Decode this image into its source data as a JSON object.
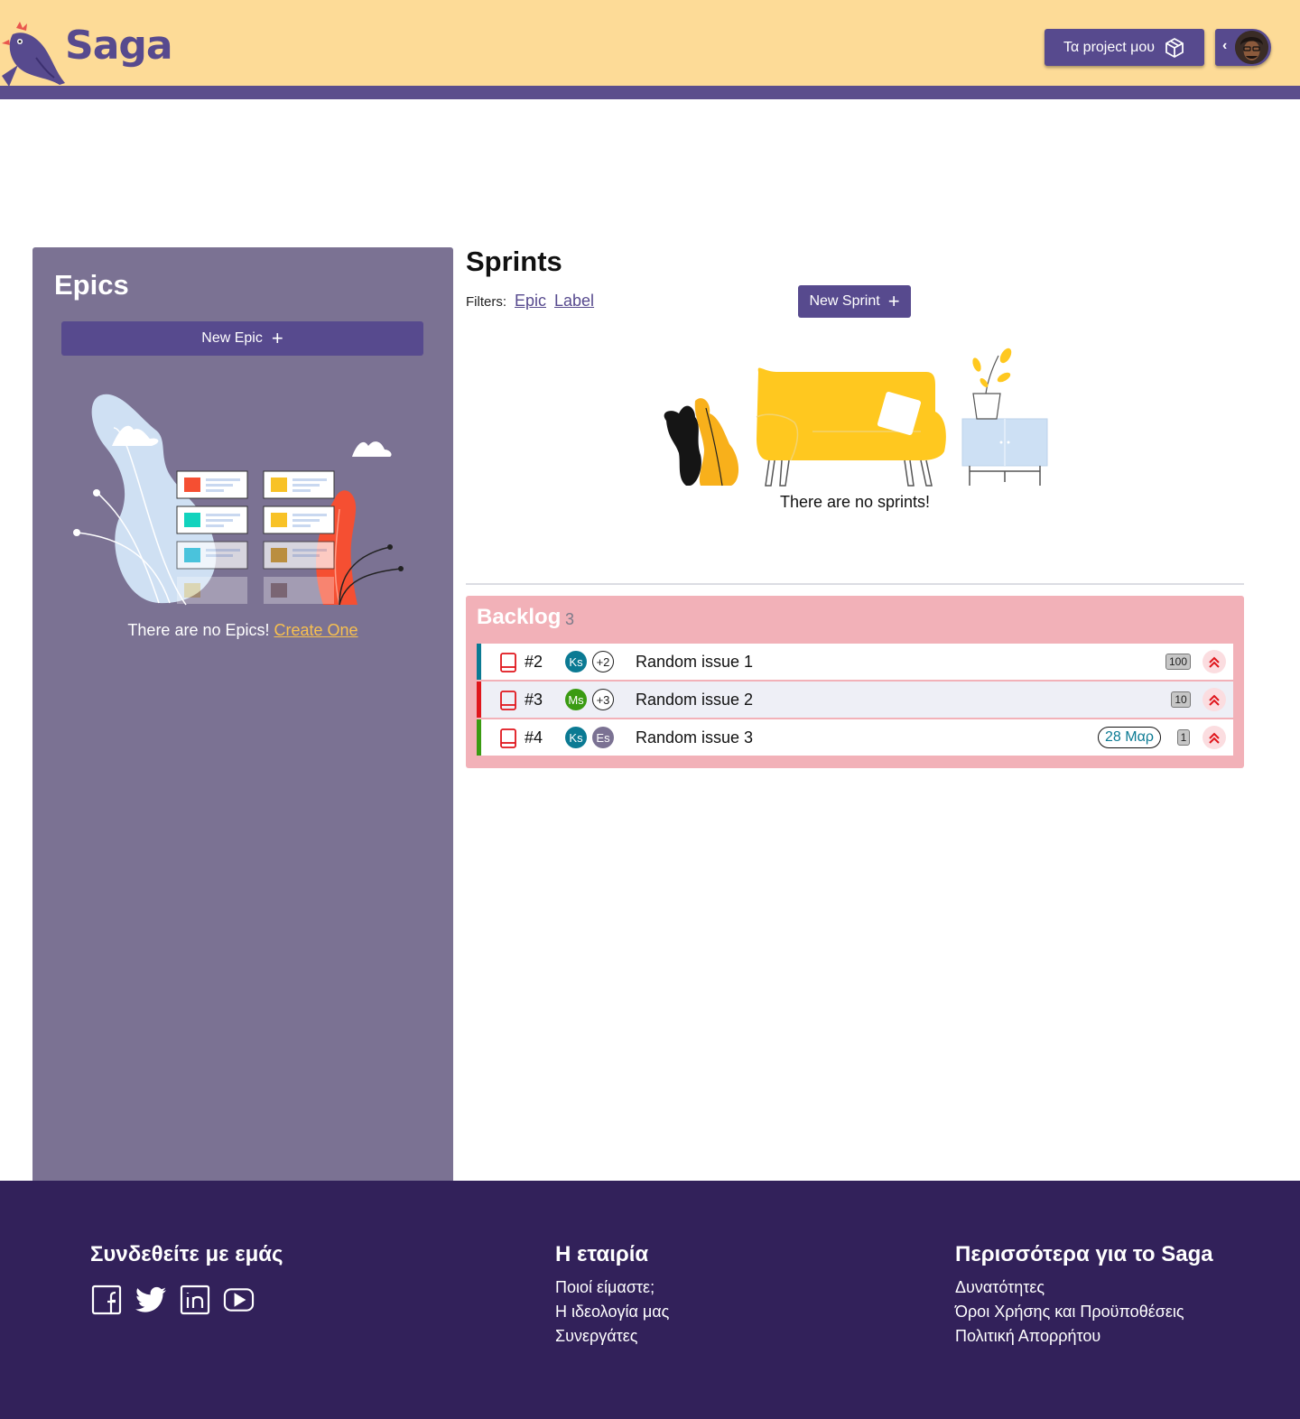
{
  "header": {
    "brand": "Saga",
    "projects_label": "Τα project μου",
    "colors": {
      "header_bg": "#fddb97",
      "accent": "#574a8e"
    }
  },
  "epics": {
    "title": "Epics",
    "new_label": "New Epic",
    "empty_text": "There are no Epics!",
    "create_link": "Create One"
  },
  "sprints": {
    "title": "Sprints",
    "filters_label": "Filters:",
    "filter_epic": "Epic",
    "filter_label": "Label",
    "new_label": "New Sprint",
    "empty_text": "There are no sprints!"
  },
  "backlog": {
    "title": "Backlog",
    "count": "3",
    "issues": [
      {
        "id": "#2",
        "assignee": "Ks",
        "assignee_color": "#0b7a93",
        "extra": "+2",
        "title": "Random issue 1",
        "points": "100",
        "stripe": "#0b7a93"
      },
      {
        "id": "#3",
        "assignee": "Ms",
        "assignee_color": "#3a9b12",
        "extra": "+3",
        "title": "Random issue 2",
        "points": "10",
        "stripe": "#e0161c"
      },
      {
        "id": "#4",
        "assignee": "Ks",
        "assignee_color": "#0b7a93",
        "extra": "Es",
        "extra_color": "#7b7293",
        "title": "Random issue 3",
        "date": "28 Μαρ",
        "points": "1",
        "stripe": "#3a9b12"
      }
    ]
  },
  "footer": {
    "col1": {
      "title": "Συνδεθείτε με εμάς"
    },
    "col2": {
      "title": "Η εταιρία",
      "links": [
        "Ποιοί είμαστε;",
        "Η ιδεολογία μας",
        "Συνεργάτες"
      ]
    },
    "col3": {
      "title": "Περισσότερα για το Saga",
      "links": [
        "Δυνατότητες",
        "Όροι Χρήσης και Προϋποθέσεις",
        "Πολιτική Απορρήτου"
      ]
    },
    "social_icons": [
      "facebook-icon",
      "twitter-icon",
      "linkedin-icon",
      "youtube-icon"
    ]
  }
}
